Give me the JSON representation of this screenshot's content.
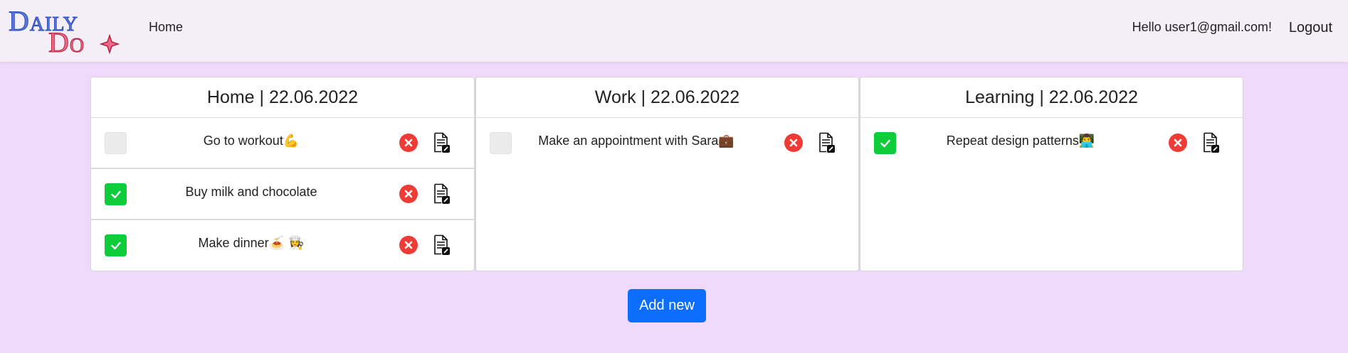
{
  "navbar": {
    "logo_line1": "Daily",
    "logo_line2": "Do",
    "home_label": "Home",
    "greeting": "Hello user1@gmail.com!",
    "logout_label": "Logout"
  },
  "columns": [
    {
      "title": "Home | 22.06.2022",
      "tasks": [
        {
          "text": "Go to workout💪",
          "done": false
        },
        {
          "text": "Buy milk and chocolate",
          "done": true
        },
        {
          "text": "Make dinner🍝 👩‍🍳",
          "done": true
        }
      ]
    },
    {
      "title": "Work | 22.06.2022",
      "tasks": [
        {
          "text": "Make an appointment with Sara💼",
          "done": false
        }
      ]
    },
    {
      "title": "Learning | 22.06.2022",
      "tasks": [
        {
          "text": "Repeat design patterns👨‍💻",
          "done": true
        }
      ]
    }
  ],
  "actions": {
    "add_new_label": "Add new"
  },
  "colors": {
    "page_bg": "#efdafb",
    "navbar_bg": "#f4eef7",
    "check_done": "#0ecc3a",
    "check_empty": "#ebebeb",
    "delete": "#ef3b35",
    "primary": "#0d6efd"
  },
  "icons": {
    "check": "checkmark-icon",
    "delete": "close-circle-icon",
    "edit": "edit-document-icon"
  }
}
